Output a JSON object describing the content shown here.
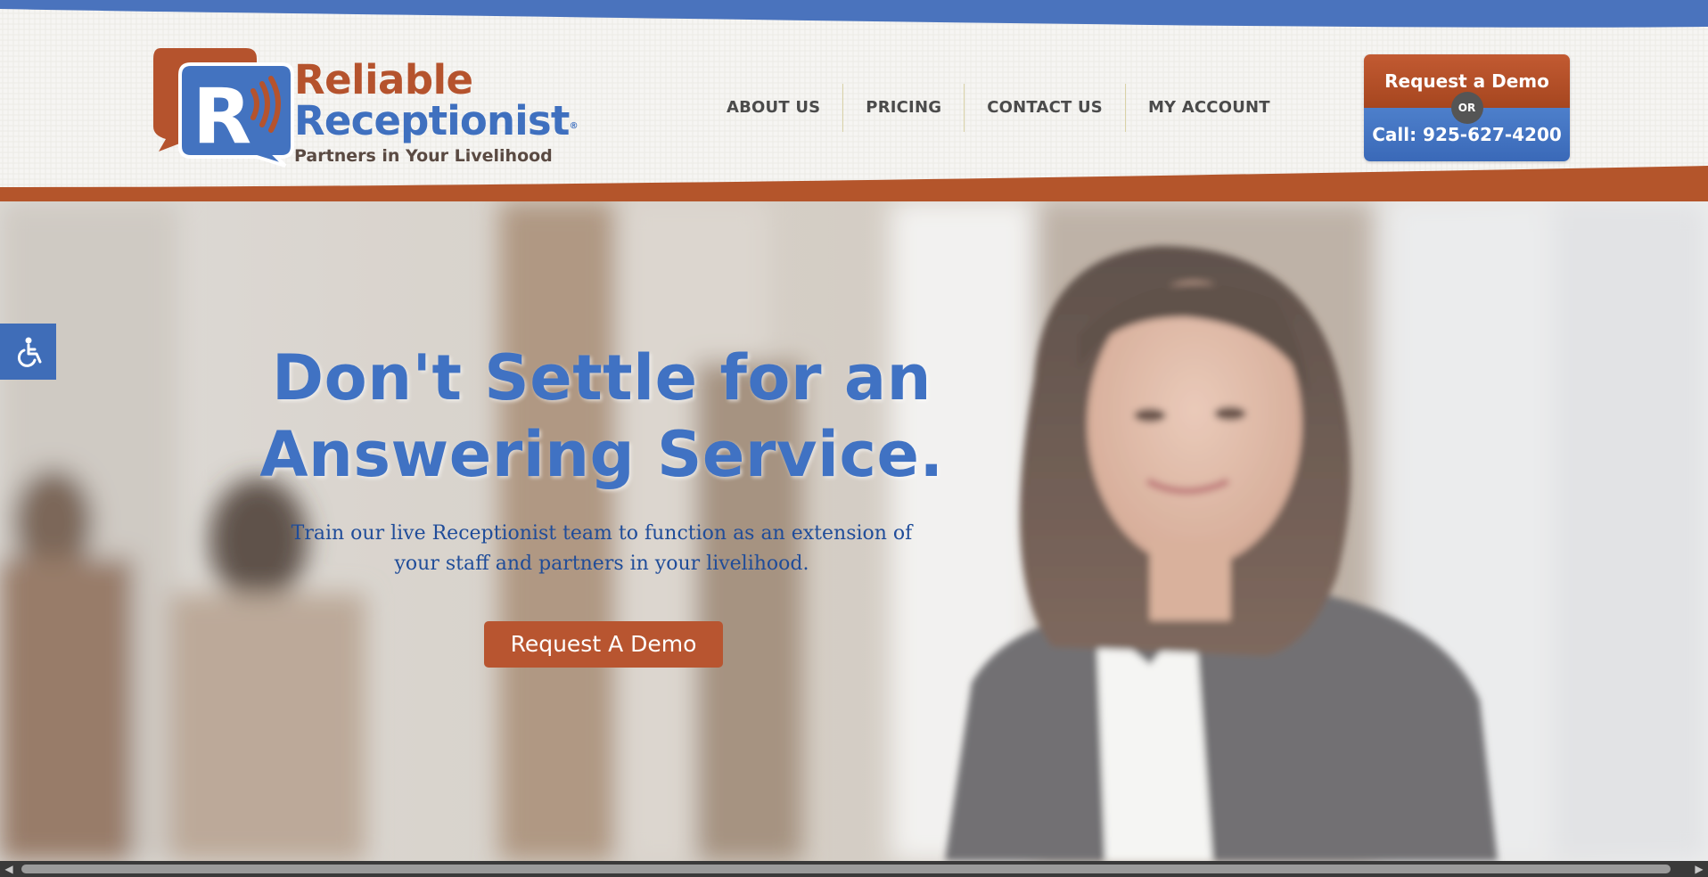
{
  "brand": {
    "name_line1": "Reliable",
    "name_line2": "Receptionist",
    "registered_mark": "®",
    "tagline": "Partners in Your Livelihood",
    "logo_letter": "R",
    "colors": {
      "orange": "#b5532d",
      "blue": "#3f70bf"
    }
  },
  "nav": {
    "items": [
      {
        "label": "ABOUT US"
      },
      {
        "label": "PRICING"
      },
      {
        "label": "CONTACT US"
      },
      {
        "label": "MY ACCOUNT"
      }
    ]
  },
  "cta": {
    "demo_label": "Request a Demo",
    "or_label": "OR",
    "call_label": "Call: 925-627-4200"
  },
  "hero": {
    "title_line1": "Don't Settle for an",
    "title_line2": "Answering Service.",
    "subtitle": "Train our live Receptionist team to function as an extension of your staff and partners in your livelihood.",
    "button_label": "Request A Demo"
  },
  "accessibility": {
    "icon": "wheelchair-icon"
  },
  "scrollbar": {
    "left_arrow": "◀",
    "right_arrow": "▶"
  }
}
